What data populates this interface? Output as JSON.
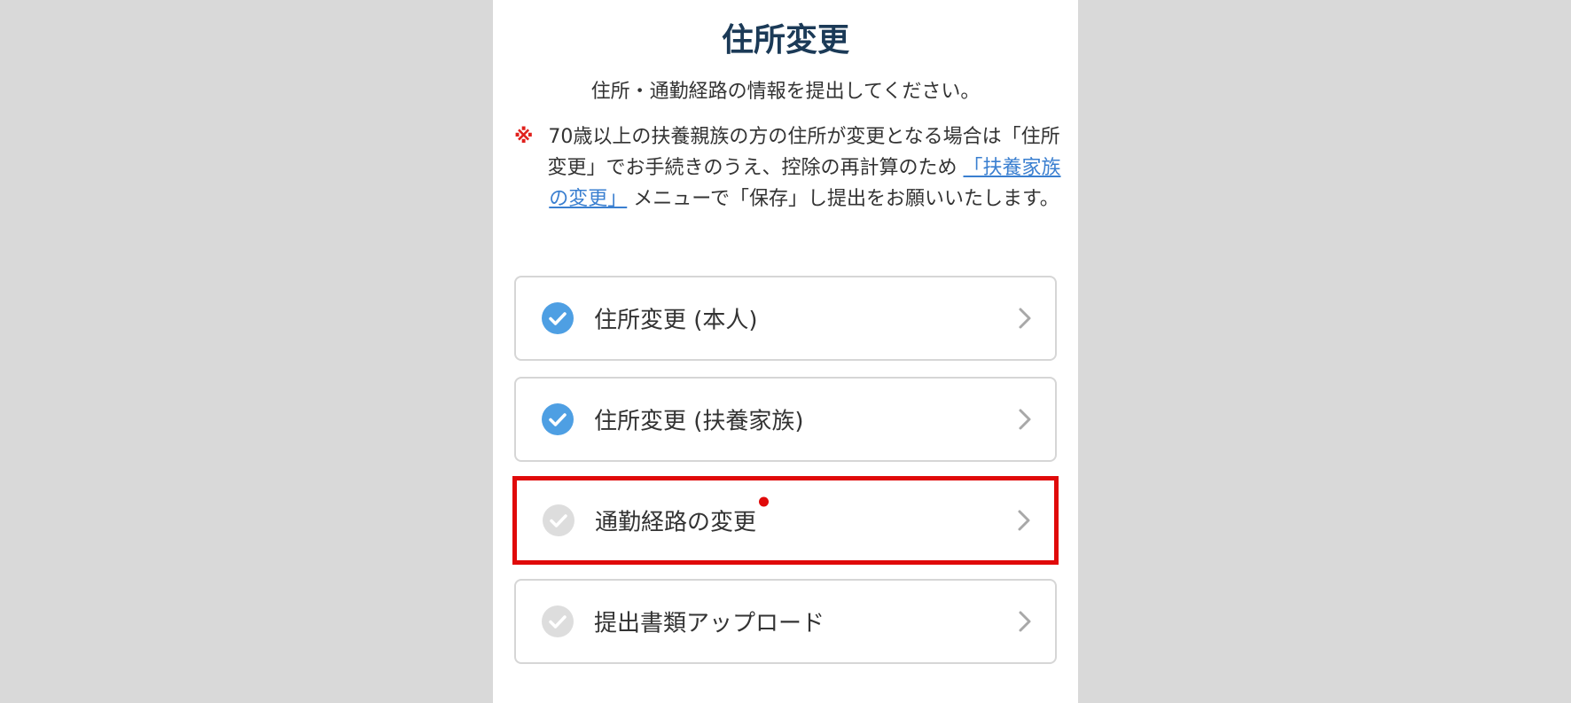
{
  "page": {
    "title": "住所変更",
    "subtitle": "住所・通勤経路の情報を提出してください。"
  },
  "notice": {
    "mark": "※",
    "text_before_link": "70歳以上の扶養親族の方の住所が変更となる場合は「住所変更」でお手続きのうえ、控除の再計算のため",
    "link_text": "「扶養家族の変更」",
    "text_after_link": "メニューで「保存」し提出をお願いいたします。",
    "link_color": "#3a7fd0",
    "mark_color": "#e0201c"
  },
  "colors": {
    "check_done": "#4e9fe3",
    "check_pending": "#dddddd",
    "highlight_border": "#e00a0a",
    "badge_dot": "#e00a0a"
  },
  "menu": {
    "items": [
      {
        "label": "住所変更 (本人)",
        "icon": "check-circle-icon",
        "status": "completed"
      },
      {
        "label": "住所変更 (扶養家族)",
        "icon": "check-circle-icon",
        "status": "completed"
      },
      {
        "label": "通勤経路の変更",
        "icon": "check-circle-icon",
        "status": "pending",
        "required_badge": true,
        "highlighted": true
      },
      {
        "label": "提出書類アップロード",
        "icon": "check-circle-icon",
        "status": "pending"
      }
    ]
  }
}
